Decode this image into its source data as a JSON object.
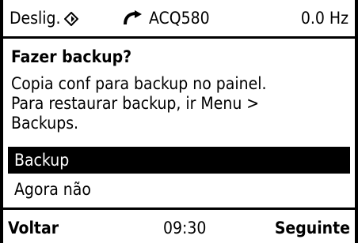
{
  "status": {
    "state": "Deslig.",
    "drive_name": "ACQ580",
    "frequency": "0.0 Hz",
    "icons": [
      "diamond-status-icon",
      "rotation-direction-icon"
    ]
  },
  "dialog": {
    "title": "Fazer backup?",
    "message_lines": [
      "Copia conf para backup no painel.",
      "Para restaurar backup, ir Menu >",
      "Backups."
    ],
    "options": [
      {
        "label": "Backup",
        "selected": true
      },
      {
        "label": "Agora não",
        "selected": false
      }
    ]
  },
  "footer": {
    "left": "Voltar",
    "time": "09:30",
    "right": "Seguinte"
  }
}
